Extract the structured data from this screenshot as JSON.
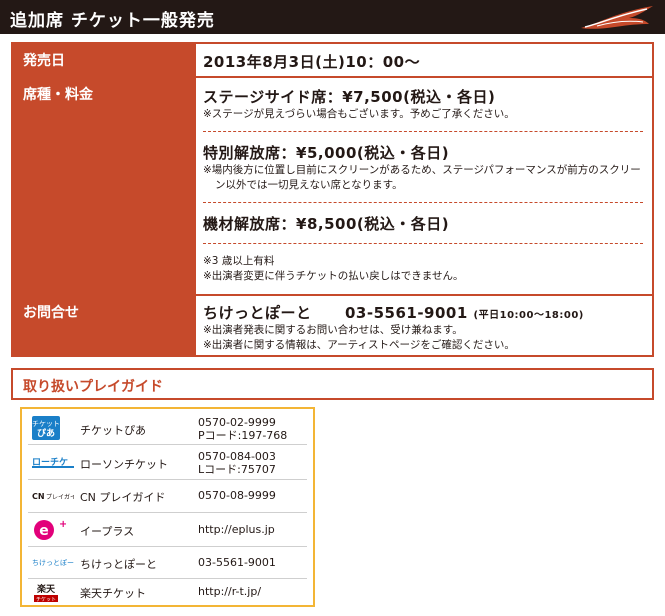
{
  "header": {
    "title": "追加席 チケット一般発売"
  },
  "colors": {
    "accent": "#c64a2b",
    "guide_border": "#f3b535",
    "header_bg": "#231815"
  },
  "sale_date": {
    "label": "発売日",
    "value": "2013年8月3日(土)10：00～"
  },
  "seats": {
    "label": "席種・料金",
    "items": [
      {
        "title": "ステージサイド席：¥7,500(税込・各日)",
        "notes": [
          "※ステージが見えづらい場合もございます。予めご了承ください。"
        ]
      },
      {
        "title": "特別解放席：¥5,000(税込・各日)",
        "notes": [
          "※場内後方に位置し目前にスクリーンがあるため、ステージパフォーマンスが前方のスクリーン以外では一切見えない席となります。"
        ]
      },
      {
        "title": "機材解放席：¥8,500(税込・各日)",
        "notes": []
      }
    ],
    "footer_notes": [
      "※3 歳以上有料",
      "※出演者変更に伴うチケットの払い戻しはできません。"
    ]
  },
  "contact": {
    "label": "お問合せ",
    "name": "ちけっとぽーと",
    "phone": "03-5561-9001",
    "hours": "(平日10:00～18:00)",
    "notes": [
      "※出演者発表に関するお問い合わせは、受け兼ねます。",
      "※出演者に関する情報は、アーティストページをご確認ください。"
    ]
  },
  "guides": {
    "title": "取り扱いプレイガイド",
    "items": [
      {
        "name": "チケットぴあ",
        "contact1": "0570-02-9999",
        "contact2": "Pコード:197-768",
        "icon": "pia-logo"
      },
      {
        "name": "ローソンチケット",
        "contact1": "0570-084-003",
        "contact2": "Lコード:75707",
        "icon": "lawson-logo"
      },
      {
        "name": "CN プレイガイド",
        "contact1": "0570-08-9999",
        "contact2": "",
        "icon": "cn-logo"
      },
      {
        "name": "イープラス",
        "contact1": "http://eplus.jp",
        "contact2": "",
        "icon": "eplus-logo"
      },
      {
        "name": "ちけっとぽーと",
        "contact1": "03-5561-9001",
        "contact2": "",
        "icon": "ticketport-logo"
      },
      {
        "name": "楽天チケット",
        "contact1": "http://r-t.jp/",
        "contact2": "",
        "icon": "rakuten-logo"
      }
    ]
  }
}
